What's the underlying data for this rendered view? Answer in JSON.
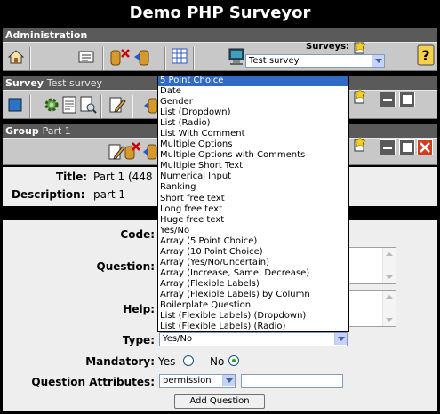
{
  "window": {
    "title": "Demo PHP Surveyor"
  },
  "administration": {
    "header": "Administration",
    "surveys_label": "Surveys:",
    "survey_select_value": "Test survey",
    "icons": [
      "home-icon",
      "list-icon",
      "database-delete-icon",
      "database-arrow-icon",
      "grid-icon",
      "terminal-icon",
      "help-icon"
    ]
  },
  "survey": {
    "header": "Survey",
    "header_sub": "Test survey",
    "icons": [
      "square-icon",
      "gear-icon",
      "document-search-icon",
      "edit-icon",
      "arrow-icon"
    ]
  },
  "group": {
    "header": "Group",
    "header_sub": "Part 1",
    "icons": [
      "edit-icon",
      "delete-icon"
    ]
  },
  "group_info": {
    "title_label": "Title:",
    "title_value": "Part 1 (448",
    "description_label": "Description:",
    "description_value": "part 1"
  },
  "question_form": {
    "code_label": "Code:",
    "question_label": "Question:",
    "help_label": "Help:",
    "type_label": "Type:",
    "type_value": "Yes/No",
    "mandatory_label": "Mandatory:",
    "mandatory_yes": "Yes",
    "mandatory_no": "No",
    "mandatory_selected": "No",
    "attributes_label": "Question Attributes:",
    "attributes_value": "permission",
    "add_button": "Add Question"
  },
  "type_dropdown": {
    "selected": "5 Point Choice",
    "options": [
      "5 Point Choice",
      "Date",
      "Gender",
      "List (Dropdown)",
      "List (Radio)",
      "List With Comment",
      "Multiple Options",
      "Multiple Options with Comments",
      "Multiple Short Text",
      "Numerical Input",
      "Ranking",
      "Short free text",
      "Long free text",
      "Huge free text",
      "Yes/No",
      "Array (5 Point Choice)",
      "Array (10 Point Choice)",
      "Array (Yes/No/Uncertain)",
      "Array (Increase, Same, Decrease)",
      "Array (Flexible Labels)",
      "Array (Flexible Labels) by Column",
      "Boilerplate Question",
      "List (Flexible Labels) (Dropdown)",
      "List (Flexible Labels) (Radio)"
    ]
  },
  "colors": {
    "background": "#000000",
    "panel_header": "#5a5a5a",
    "toolbar": "#c8c8c8",
    "form_bg": "#eeeeee",
    "selection": "#316ac5"
  }
}
